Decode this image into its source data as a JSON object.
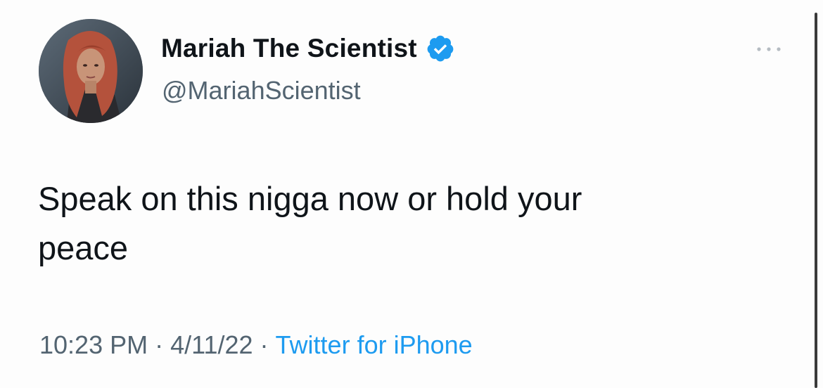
{
  "author": {
    "display_name": "Mariah The Scientist",
    "handle": "@MariahScientist",
    "verified": true,
    "avatar_icon": "profile-photo",
    "verified_icon": "verified-badge-icon",
    "verified_color": "#1d9bf0"
  },
  "menu": {
    "icon": "more-options-icon"
  },
  "tweet": {
    "text": "Speak on this nigga now or hold your\npeace"
  },
  "meta": {
    "time": "10:23 PM",
    "separator": "·",
    "date": "4/11/22",
    "source": "Twitter for iPhone",
    "source_color": "#1d9bf0"
  }
}
